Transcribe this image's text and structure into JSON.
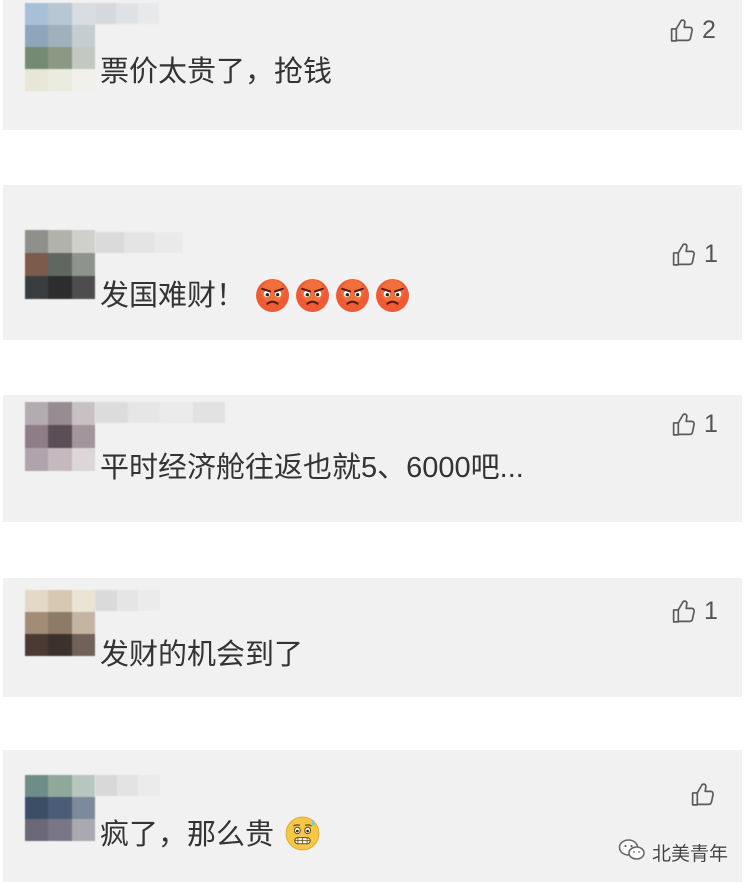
{
  "comments": [
    {
      "text": "票价太贵了，抢钱",
      "likes": "2",
      "like_icon": "thumbs-up-icon"
    },
    {
      "text": "发国难财！",
      "likes": "1",
      "like_icon": "thumbs-up-icon",
      "emoji": [
        "angry-face-icon",
        "angry-face-icon",
        "angry-face-icon",
        "angry-face-icon"
      ]
    },
    {
      "text": "平时经济舱往返也就5、6000吧...",
      "likes": "1",
      "like_icon": "thumbs-up-icon"
    },
    {
      "text": "发财的机会到了",
      "likes": "1",
      "like_icon": "thumbs-up-icon"
    },
    {
      "text": "疯了，那么贵",
      "like_icon": "thumbs-up-icon",
      "emoji": [
        "grimace-sweat-face-icon"
      ]
    }
  ],
  "watermark": {
    "text": "北美青年",
    "icon": "wechat-icon"
  },
  "colors": {
    "card_background": "#f1f1f1",
    "text": "#333333",
    "icon": "#5a5a5a",
    "angry_emoji": "#ee5b34",
    "grimace_emoji": "#f6c646"
  }
}
